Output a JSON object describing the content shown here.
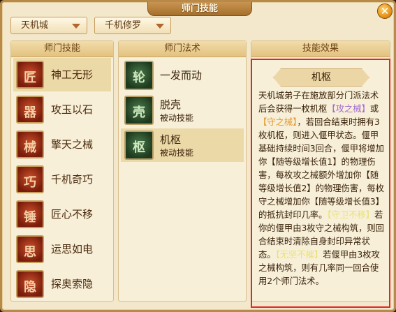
{
  "window": {
    "title": "师门技能",
    "close_label": "✕"
  },
  "filters": {
    "sect": "天机城",
    "path": "千机修罗"
  },
  "panels": {
    "skills_header": "师门技能",
    "techniques_header": "师门法术",
    "effect_header": "技能效果"
  },
  "skills": [
    {
      "name": "神工无形",
      "glyph": "匠"
    },
    {
      "name": "攻玉以石",
      "glyph": "器"
    },
    {
      "name": "擎天之械",
      "glyph": "械"
    },
    {
      "name": "千机奇巧",
      "glyph": "巧"
    },
    {
      "name": "匠心不移",
      "glyph": "锤"
    },
    {
      "name": "运思如电",
      "glyph": "思"
    },
    {
      "name": "探奥索隐",
      "glyph": "隐"
    }
  ],
  "techniques": [
    {
      "name": "一发而动",
      "sub": "",
      "glyph": "轮"
    },
    {
      "name": "脱壳",
      "sub": "被动技能",
      "glyph": "壳"
    },
    {
      "name": "机枢",
      "sub": "被动技能",
      "glyph": "枢"
    }
  ],
  "effect": {
    "title": "机枢",
    "p1_a": "天机城弟子在施放部分门派法术后会获得一枚机枢",
    "p1_link1": "【攻之械】",
    "p1_b": "或",
    "p1_link2": "【守之械】",
    "p1_c": "，若回合结束时拥有3枚机枢，则进入偃甲状态。偃甲基础持续时间3回合，偃甲将增加你【随等级增长值1】的物理伤害，每枚攻之械额外增加你【随等级增长值2】的物理伤害，每枚守之械增加你【随等级增长值3】的抵抗封印几率。",
    "p2_tag": "【守卫不移】",
    "p2_text": "若你的偃甲由3枚守之械构筑，则回合结束时清除自身封印异常状态。",
    "p3_tag": "【无坚不摧】",
    "p3_text": "若偃甲由3枚攻之械构筑，则有几率同一回合使用2个师门法术。"
  },
  "colors": {
    "highlight_border": "#e0262a",
    "link_purple": "#a46bd6",
    "link_orange": "#e6982f",
    "tag_yellow": "#e8e27a"
  }
}
